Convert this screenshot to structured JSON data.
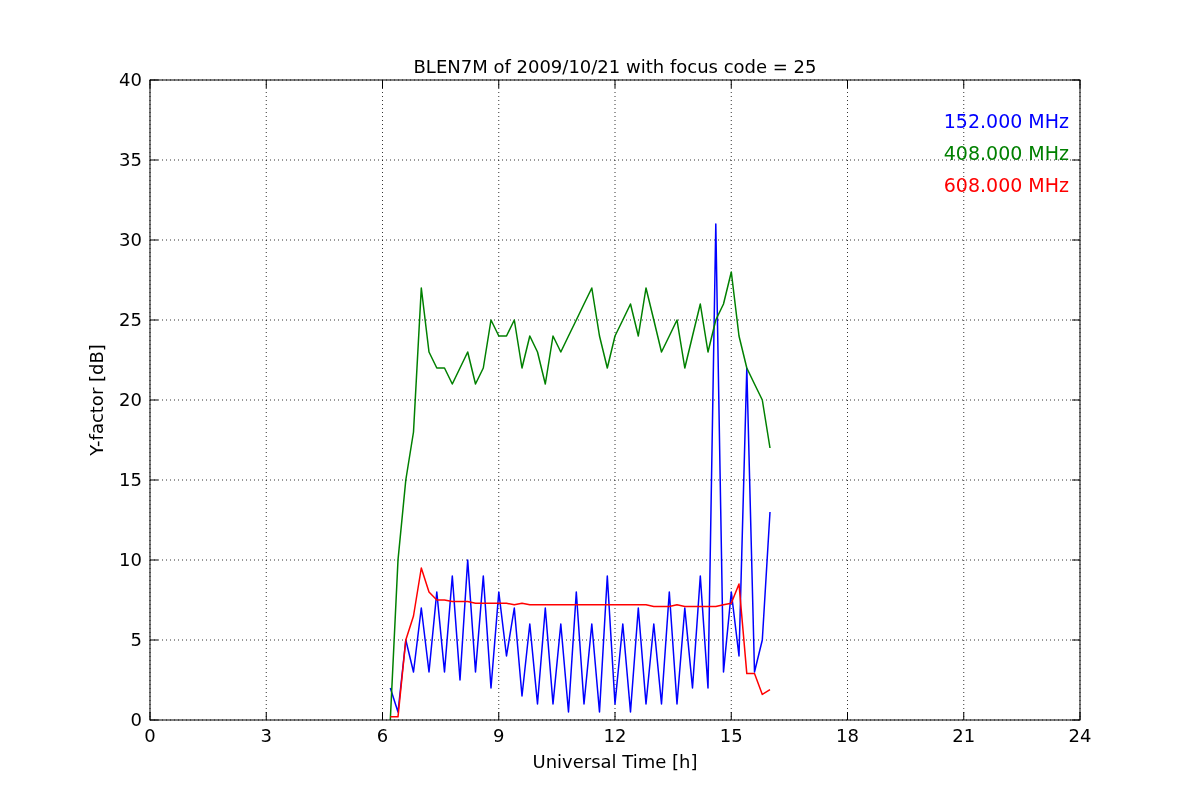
{
  "chart_data": {
    "type": "line",
    "title": "BLEN7M of 2009/10/21 with focus code = 25",
    "xlabel": "Universal Time [h]",
    "ylabel": "Y-factor [dB]",
    "x": [
      6.2,
      6.4,
      6.6,
      6.8,
      7.0,
      7.2,
      7.4,
      7.6,
      7.8,
      8.0,
      8.2,
      8.4,
      8.6,
      8.8,
      9.0,
      9.2,
      9.4,
      9.6,
      9.8,
      10.0,
      10.2,
      10.4,
      10.6,
      10.8,
      11.0,
      11.2,
      11.4,
      11.6,
      11.8,
      12.0,
      12.2,
      12.4,
      12.6,
      12.8,
      13.0,
      13.2,
      13.4,
      13.6,
      13.8,
      14.0,
      14.2,
      14.4,
      14.6,
      14.8,
      15.0,
      15.2,
      15.4,
      15.6,
      15.8,
      16.0
    ],
    "series": [
      {
        "name": "152.000 MHz",
        "color": "#0000ff",
        "values": [
          2,
          0.5,
          5,
          3,
          7,
          3,
          8,
          3,
          9,
          2.5,
          10,
          3,
          9,
          2,
          8,
          4,
          7,
          1.5,
          6,
          1,
          7,
          1,
          6,
          0.5,
          8,
          1,
          6,
          0.5,
          9,
          1,
          6,
          0.5,
          7,
          1,
          6,
          1,
          8,
          1,
          7,
          2,
          9,
          2,
          31,
          3,
          8,
          4,
          22,
          3,
          5,
          13
        ]
      },
      {
        "name": "408.000 MHz",
        "color": "#008000",
        "values": [
          0,
          10,
          15,
          18,
          27,
          23,
          22,
          22,
          21,
          22,
          23,
          21,
          22,
          25,
          24,
          24,
          25,
          22,
          24,
          23,
          21,
          24,
          23,
          24,
          25,
          26,
          27,
          24,
          22,
          24,
          25,
          26,
          24,
          27,
          25,
          23,
          24,
          25,
          22,
          24,
          26,
          23,
          25,
          26,
          28,
          24,
          22,
          21,
          20,
          17
        ]
      },
      {
        "name": "608.000 MHz",
        "color": "#ff0000",
        "values": [
          0.2,
          0.2,
          5,
          6.5,
          9.5,
          8,
          7.5,
          7.5,
          7.4,
          7.4,
          7.4,
          7.3,
          7.3,
          7.3,
          7.3,
          7.3,
          7.2,
          7.3,
          7.2,
          7.2,
          7.2,
          7.2,
          7.2,
          7.2,
          7.2,
          7.2,
          7.2,
          7.2,
          7.2,
          7.2,
          7.2,
          7.2,
          7.2,
          7.2,
          7.1,
          7.1,
          7.1,
          7.2,
          7.1,
          7.1,
          7.1,
          7.1,
          7.1,
          7.2,
          7.3,
          8.5,
          2.9,
          2.9,
          1.6,
          1.9
        ]
      }
    ],
    "xlim": [
      0,
      24
    ],
    "ylim": [
      0,
      40
    ],
    "xticks": [
      0,
      3,
      6,
      9,
      12,
      15,
      18,
      21,
      24
    ],
    "yticks": [
      0,
      5,
      10,
      15,
      20,
      25,
      30,
      35,
      40
    ],
    "grid": true
  }
}
